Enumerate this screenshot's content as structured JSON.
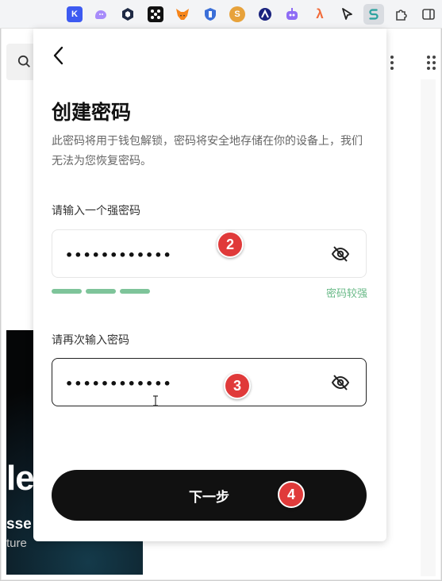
{
  "toolbar": {
    "extensions": [
      {
        "name": "k-extension-icon",
        "glyph": "K",
        "color": "#3d5af1"
      },
      {
        "name": "ghost-extension-icon",
        "glyph": "",
        "color": "#a78bfa"
      },
      {
        "name": "hex-extension-icon",
        "glyph": "",
        "color": "#1f2a44"
      },
      {
        "name": "dice-extension-icon",
        "glyph": "",
        "color": "#111111"
      },
      {
        "name": "metamask-fox-icon",
        "glyph": "",
        "color": "#f6851b"
      },
      {
        "name": "shield-extension-icon",
        "glyph": "",
        "color": "#3b6fd8"
      },
      {
        "name": "s-coin-extension-icon",
        "glyph": "S",
        "color": "#e7a23b"
      },
      {
        "name": "circle-a-extension-icon",
        "glyph": "",
        "color": "#1a237e"
      },
      {
        "name": "robot-extension-icon",
        "glyph": "",
        "color": "#8e6cf5"
      },
      {
        "name": "lambda-extension-icon",
        "glyph": "λ",
        "color": "#f26b3a"
      },
      {
        "name": "arrow-extension-icon",
        "glyph": "",
        "color": "#222222"
      },
      {
        "name": "s-wallet-extension-icon",
        "glyph": "S",
        "color": "#2ea3a0"
      },
      {
        "name": "puzzle-extensions-icon",
        "glyph": "",
        "color": "#444444"
      },
      {
        "name": "side-panel-icon",
        "glyph": "",
        "color": "#444444"
      }
    ]
  },
  "background": {
    "hero_big_text": "le",
    "hero_line2": "sse",
    "hero_line3": "ture"
  },
  "popup": {
    "title": "创建密码",
    "description": "此密码将用于钱包解锁，密码将安全地存储在你的设备上，我们无法为您恢复密码。",
    "password_label": "请输入一个强密码",
    "password_value": "••••••••••••",
    "strength_label": "密码较强",
    "strength_level": 3,
    "strength_max": 3,
    "confirm_label": "请再次输入密码",
    "confirm_value": "••••••••••••",
    "next_button": "下一步"
  },
  "annotations": {
    "step2": "2",
    "step3": "3",
    "step4": "4"
  },
  "colors": {
    "strength_green": "#7ec49a",
    "badge_red": "#e03a3a",
    "button_black": "#111111"
  }
}
